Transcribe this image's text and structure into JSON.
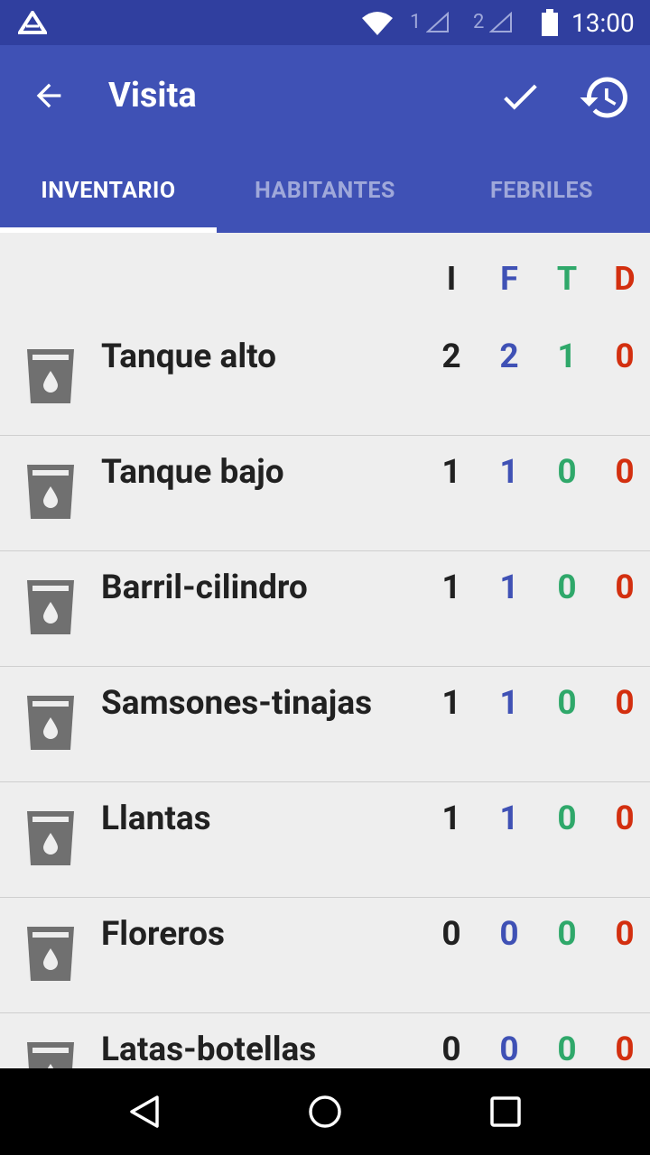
{
  "status_bar": {
    "sim1": "1",
    "sim2": "2",
    "time": "13:00"
  },
  "app_bar": {
    "title": "Visita"
  },
  "tabs": [
    {
      "label": "INVENTARIO"
    },
    {
      "label": "HABITANTES"
    },
    {
      "label": "FEBRILES"
    }
  ],
  "columns": {
    "i": "I",
    "f": "F",
    "t": "T",
    "d": "D"
  },
  "items": [
    {
      "name": "Tanque alto",
      "i": "2",
      "f": "2",
      "t": "1",
      "d": "0"
    },
    {
      "name": "Tanque bajo",
      "i": "1",
      "f": "1",
      "t": "0",
      "d": "0"
    },
    {
      "name": "Barril-cilindro",
      "i": "1",
      "f": "1",
      "t": "0",
      "d": "0"
    },
    {
      "name": "Samsones-tinajas",
      "i": "1",
      "f": "1",
      "t": "0",
      "d": "0"
    },
    {
      "name": "Llantas",
      "i": "1",
      "f": "1",
      "t": "0",
      "d": "0"
    },
    {
      "name": "Floreros",
      "i": "0",
      "f": "0",
      "t": "0",
      "d": "0"
    },
    {
      "name": "Latas-botellas",
      "i": "0",
      "f": "0",
      "t": "0",
      "d": "0"
    }
  ],
  "colors": {
    "primary": "#3f51b5",
    "primary_dark": "#303f9f",
    "col_i": "#212121",
    "col_f": "#3f51b5",
    "col_t": "#2fa86a",
    "col_d": "#d32f0f"
  }
}
